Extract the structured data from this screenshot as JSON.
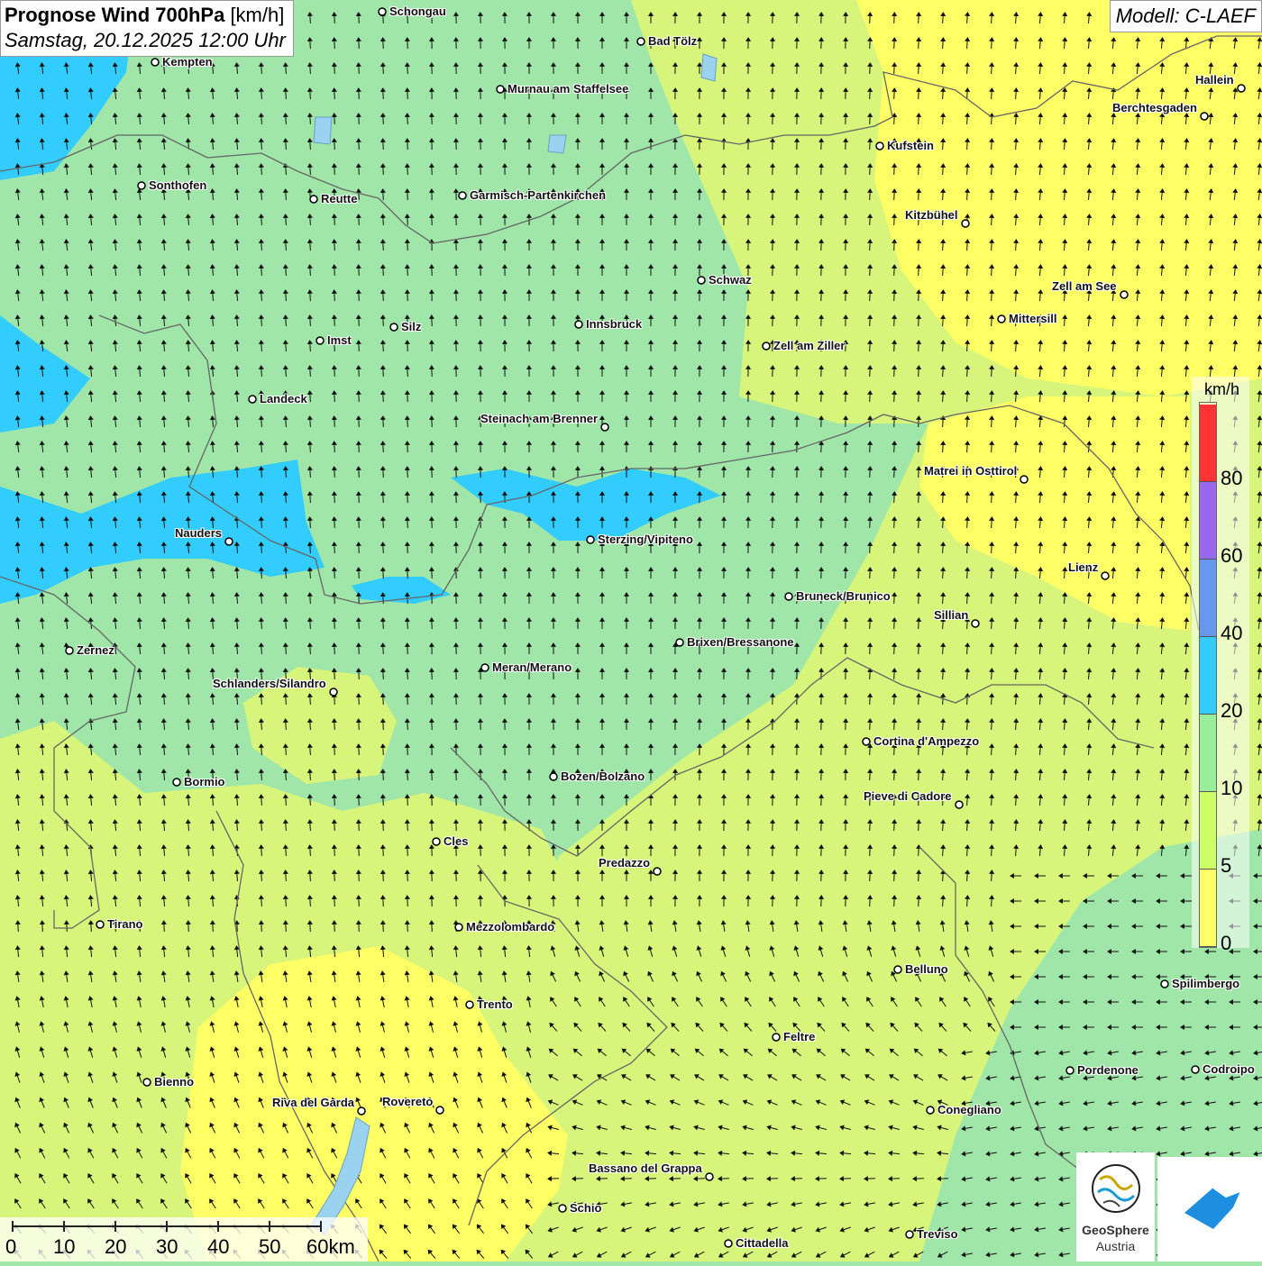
{
  "header": {
    "title_bold": "Prognose Wind 700hPa",
    "title_unit": "[km/h]",
    "datetime": "Samstag, 20.12.2025 12:00 Uhr",
    "model": "Modell: C-LAEF"
  },
  "legend": {
    "unit": "km/h",
    "bins": [
      {
        "from": 0,
        "to": 5,
        "color": "#ffff66"
      },
      {
        "from": 5,
        "to": 10,
        "color": "#ccff66"
      },
      {
        "from": 10,
        "to": 20,
        "color": "#99ee99"
      },
      {
        "from": 20,
        "to": 40,
        "color": "#33ccff"
      },
      {
        "from": 40,
        "to": 60,
        "color": "#6699ee"
      },
      {
        "from": 60,
        "to": 80,
        "color": "#9966ee"
      },
      {
        "from": 80,
        "to": 100,
        "color": "#ff3333"
      }
    ],
    "tick_labels": [
      "0",
      "5",
      "10",
      "20",
      "40",
      "60",
      "80"
    ]
  },
  "map_colors": {
    "calm": "#ffff66",
    "light": "#d6f57a",
    "moderate": "#9fe6a8",
    "strong": "#33ccff",
    "border": "#666666",
    "arrow": "#111111"
  },
  "cities": [
    "Schongau",
    "Bad Tölz",
    "Kempten",
    "Murnau am Staffelsee",
    "Hallein",
    "Berchtesgaden",
    "Kufstein",
    "Sonthofen",
    "Reutte",
    "Garmisch-Partenkirchen",
    "Kitzbühel",
    "Schwaz",
    "Zell am See",
    "Mittersill",
    "Innsbruck",
    "Silz",
    "Imst",
    "Zell am Ziller",
    "Landeck",
    "Steinach am Brenner",
    "Matrei in Osttirol",
    "Nauders",
    "Sterzing/Vipiteno",
    "Lienz",
    "Bruneck/Brunico",
    "Sillian",
    "Brixen/Bressanone",
    "Zernez",
    "Meran/Merano",
    "Schlanders/Silandro",
    "Cortina d'Ampezzo",
    "Bozen/Bolzano",
    "Bormio",
    "Pieve di Cadore",
    "Cles",
    "Predazzo",
    "Tirano",
    "Mezzolombardo",
    "Belluno",
    "Spilimbergo",
    "Trento",
    "Feltre",
    "Pordenone",
    "Codroipo",
    "Bienno",
    "Riva del Garda",
    "Rovereto",
    "Conegliano",
    "Bassano del Grappa",
    "Schio",
    "Treviso",
    "Cittadella"
  ],
  "scale": {
    "ticks": [
      "0",
      "10",
      "20",
      "30",
      "40",
      "50",
      "60km"
    ]
  },
  "logos": {
    "geosphere_name": "GeoSphere",
    "geosphere_sub": "Austria"
  }
}
